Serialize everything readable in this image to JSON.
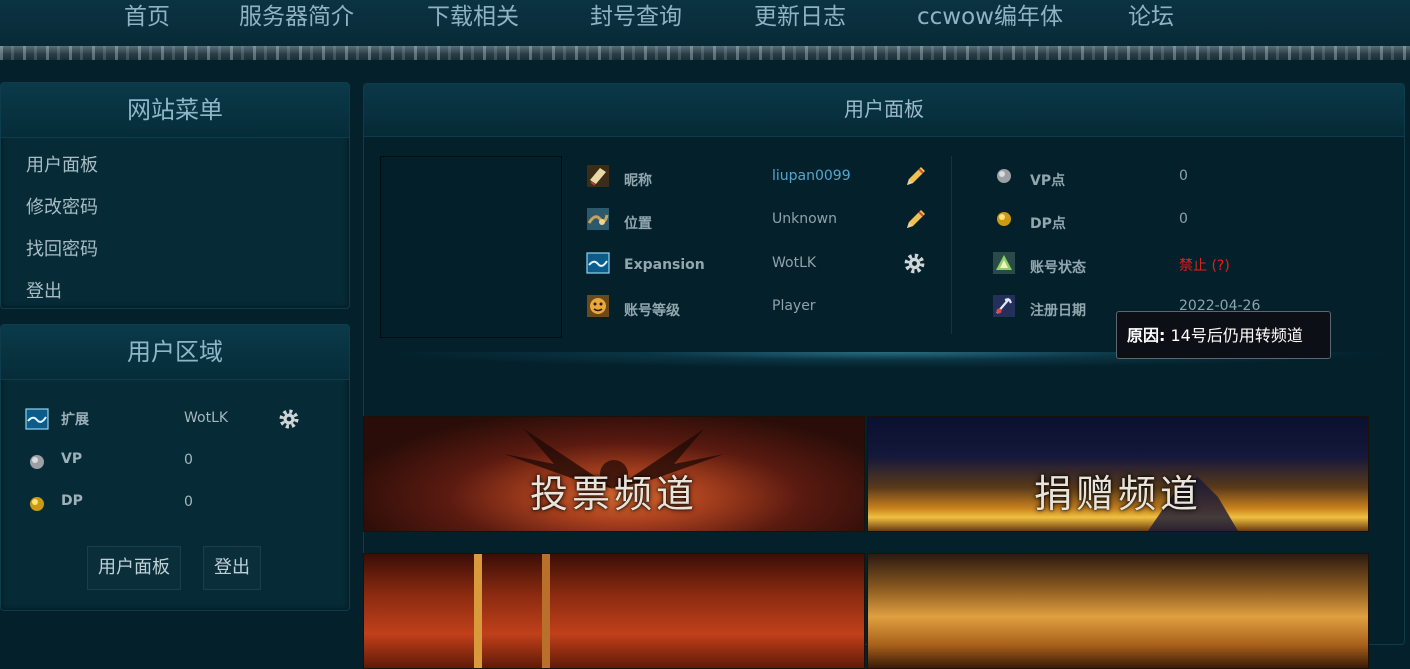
{
  "nav": {
    "items": [
      "首页",
      "服务器简介",
      "下载相关",
      "封号查询",
      "更新日志",
      "ccwow编年体",
      "论坛"
    ]
  },
  "sidebar": {
    "menu_title": "网站菜单",
    "menu_items": [
      "用户面板",
      "修改密码",
      "找回密码",
      "登出"
    ],
    "user_area_title": "用户区域",
    "user_area": [
      {
        "label": "扩展",
        "value": "WotLK",
        "icon": "expansion-icon"
      },
      {
        "label": "VP",
        "value": "0",
        "icon": "vp-coin-icon"
      },
      {
        "label": "DP",
        "value": "0",
        "icon": "dp-coin-icon"
      }
    ],
    "buttons": {
      "panel": "用户面板",
      "logout": "登出"
    }
  },
  "main": {
    "title": "用户面板",
    "left_info": [
      {
        "label": "昵称",
        "value": "liupan0099",
        "icon": "nickname-icon",
        "action_icon": "edit-pencil-icon"
      },
      {
        "label": "位置",
        "value": "Unknown",
        "icon": "location-icon",
        "action_icon": "edit-pencil-icon"
      },
      {
        "label": "Expansion",
        "value": "WotLK",
        "icon": "expansion-icon",
        "action_icon": "gear-icon"
      },
      {
        "label": "账号等级",
        "value": "Player",
        "icon": "account-level-icon"
      }
    ],
    "right_info": [
      {
        "label": "VP点",
        "value": "0",
        "icon": "vp-coin-icon"
      },
      {
        "label": "DP点",
        "value": "0",
        "icon": "dp-coin-icon"
      },
      {
        "label": "账号状态",
        "value": "禁止 (?)",
        "icon": "account-status-icon"
      },
      {
        "label": "注册日期",
        "value": "2022-04-26",
        "icon": "register-date-icon"
      }
    ],
    "banners": [
      "投票频道",
      "捐赠频道",
      "",
      ""
    ]
  },
  "tooltip": {
    "label": "原因:",
    "text": " 14号后仍用转频道"
  },
  "colors": {
    "link": "#4fa8d0",
    "banned": "#e0201a",
    "accent": "#8eb6c8"
  }
}
